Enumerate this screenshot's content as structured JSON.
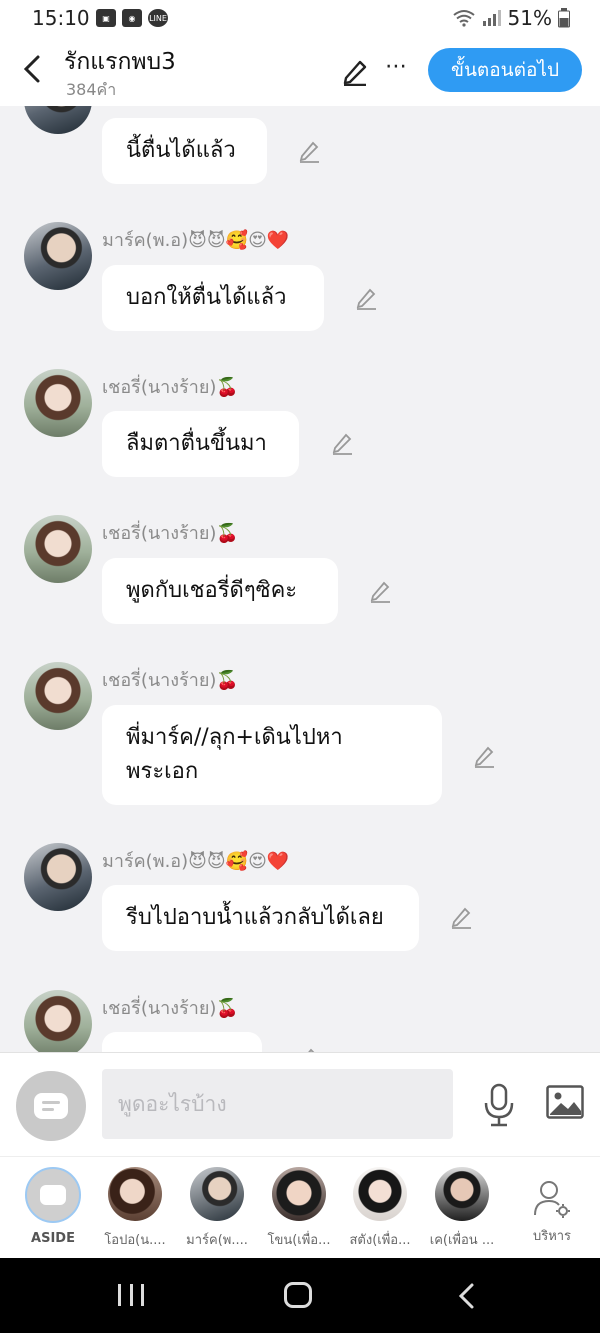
{
  "status_bar": {
    "time": "15:10",
    "battery": "51%"
  },
  "header": {
    "title": "รักแรกพบ3",
    "word_count": "384คำ",
    "next_label": "ขั้นตอนต่อไป"
  },
  "messages": [
    {
      "character": "mark",
      "name": "",
      "text": "นี้ตื่นได้แล้ว"
    },
    {
      "character": "mark",
      "name": "มาร์ค(พ.อ)😈😈🥰😍❤️",
      "text": "บอกให้ตื่นได้แล้ว"
    },
    {
      "character": "cherry",
      "name": "เชอรี่(นางร้าย)🍒",
      "text": "ลืมตาตื่นขึ้นมา"
    },
    {
      "character": "cherry",
      "name": "เชอรี่(นางร้าย)🍒",
      "text": "พูดกับเชอรี่ดีๆซิคะ"
    },
    {
      "character": "cherry",
      "name": "เชอรี่(นางร้าย)🍒",
      "text": "พี่มาร์ค//ลุก+เดินไปหา\nพระเอก"
    },
    {
      "character": "mark",
      "name": "มาร์ค(พ.อ)😈😈🥰😍❤️",
      "text": "รีบไปอาบน้ำแล้วกลับได้เลย"
    },
    {
      "character": "cherry",
      "name": "เชอรี่(นางร้าย)🍒",
      "text": ""
    }
  ],
  "composer": {
    "placeholder": "พูดอะไรบ้าง"
  },
  "roster": {
    "aside_label": "ASIDE",
    "characters": [
      {
        "label": "โอปอ(น...."
      },
      {
        "label": "มาร์ค(พ...."
      },
      {
        "label": "โขน(เพื่อ..."
      },
      {
        "label": "สตัง(เพื่อ..."
      },
      {
        "label": "เค(เพื่อน ..."
      }
    ],
    "manage_label": "บริหาร"
  },
  "colors": {
    "accent": "#2f9bf3",
    "background": "#f2f2f4"
  }
}
